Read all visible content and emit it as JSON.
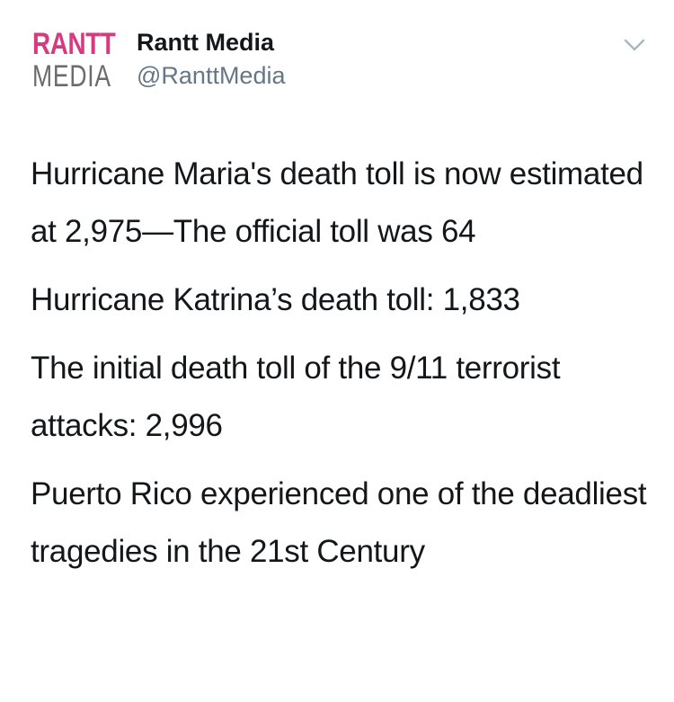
{
  "account": {
    "logo_line1": "RANTT",
    "logo_line2": "MEDIA",
    "display_name": "Rantt Media",
    "handle": "@RanttMedia"
  },
  "tweet": {
    "paragraphs": [
      "Hurricane Maria's death toll is now estimated at 2,975—The official toll was 64",
      "Hurricane Katrina’s death toll: 1,833",
      "The initial death toll of the 9/11 terrorist attacks: 2,996",
      "Puerto Rico experienced one of the deadliest tragedies in the 21st Century"
    ]
  },
  "colors": {
    "brand_pink": "#d63a7f",
    "text_primary": "#14171a",
    "text_secondary": "#657786"
  },
  "icons": {
    "menu": "chevron-down-icon"
  }
}
